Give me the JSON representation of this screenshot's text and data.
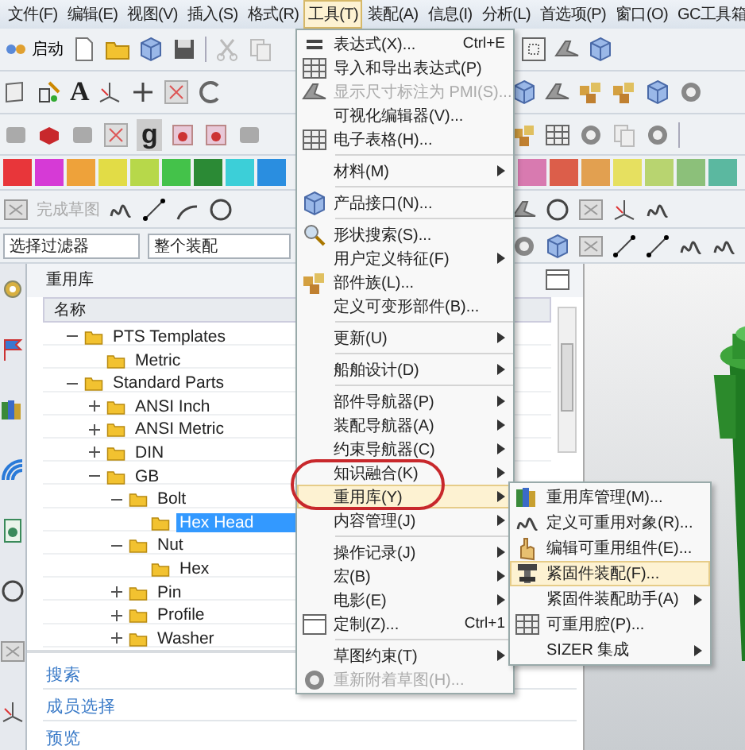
{
  "menu_bar": [
    {
      "label": "文件(F)",
      "selected": false
    },
    {
      "label": "编辑(E)",
      "selected": false
    },
    {
      "label": "视图(V)",
      "selected": false
    },
    {
      "label": "插入(S)",
      "selected": false
    },
    {
      "label": "格式(R)",
      "selected": false
    },
    {
      "label": "工具(T)",
      "selected": true
    },
    {
      "label": "装配(A)",
      "selected": false
    },
    {
      "label": "信息(I)",
      "selected": false
    },
    {
      "label": "分析(L)",
      "selected": false
    },
    {
      "label": "首选项(P)",
      "selected": false
    },
    {
      "label": "窗口(O)",
      "selected": false
    },
    {
      "label": "GC工具箱",
      "selected": false
    }
  ],
  "toolbars": {
    "launcher": {
      "label": "启动"
    },
    "glyphs": [
      "A",
      "g"
    ],
    "sketch_finish": {
      "label": "完成草图",
      "disabled": true
    },
    "filters": [
      {
        "value": "选择过滤器"
      },
      {
        "value": "整个装配"
      }
    ],
    "palette_left": [
      {
        "color": "#e8363a"
      },
      {
        "color": "#d63ad6"
      },
      {
        "color": "#eea23a"
      },
      {
        "color": "#e2dc46"
      },
      {
        "color": "#b7d84a"
      },
      {
        "color": "#44c24a"
      },
      {
        "color": "#2b8a35"
      },
      {
        "color": "#3ccfd8"
      },
      {
        "color": "#2a8ee0"
      }
    ],
    "palette_right": [
      {
        "color": "#d87ab0"
      },
      {
        "color": "#dc5e4a"
      },
      {
        "color": "#e2a050"
      },
      {
        "color": "#e6e060"
      },
      {
        "color": "#b8d470"
      },
      {
        "color": "#8cc07a"
      },
      {
        "color": "#5bb8a0"
      }
    ]
  },
  "panel": {
    "title": "重用库",
    "column": "名称",
    "tree": [
      {
        "label": "PTS Templates",
        "expanded": true,
        "selected": false,
        "children": [
          {
            "label": "Metric",
            "selected": false
          }
        ]
      },
      {
        "label": "Standard Parts",
        "expanded": true,
        "selected": false,
        "children": [
          {
            "label": "ANSI Inch",
            "expanded": false,
            "selected": false
          },
          {
            "label": "ANSI Metric",
            "expanded": false,
            "selected": false
          },
          {
            "label": "DIN",
            "expanded": false,
            "selected": false
          },
          {
            "label": "GB",
            "expanded": true,
            "selected": false,
            "children": [
              {
                "label": "Bolt",
                "expanded": true,
                "selected": false,
                "children": [
                  {
                    "label": "Hex Head",
                    "selected": true
                  }
                ]
              },
              {
                "label": "Nut",
                "expanded": true,
                "selected": false,
                "children": [
                  {
                    "label": "Hex",
                    "selected": false
                  }
                ]
              },
              {
                "label": "Pin",
                "expanded": false,
                "selected": false
              },
              {
                "label": "Profile",
                "expanded": false,
                "selected": false
              },
              {
                "label": "Washer",
                "expanded": false,
                "selected": false
              }
            ]
          }
        ]
      }
    ],
    "sections": [
      "搜索",
      "成员选择",
      "预览"
    ]
  },
  "tools_menu": {
    "items": [
      {
        "kind": "item",
        "label": "表达式(X)...",
        "shortcut": "Ctrl+E",
        "submenu": false,
        "disabled": false,
        "selected": false
      },
      {
        "kind": "item",
        "label": "导入和导出表达式(P)",
        "submenu": false,
        "disabled": false,
        "selected": false
      },
      {
        "kind": "item",
        "label": "显示尺寸标注为 PMI(S)...",
        "submenu": false,
        "disabled": true,
        "selected": false
      },
      {
        "kind": "item",
        "label": "可视化编辑器(V)...",
        "submenu": false,
        "disabled": false,
        "selected": false
      },
      {
        "kind": "item",
        "label": "电子表格(H)...",
        "submenu": false,
        "disabled": false,
        "selected": false
      },
      {
        "kind": "separator"
      },
      {
        "kind": "item",
        "label": "材料(M)",
        "submenu": true,
        "disabled": false,
        "selected": false
      },
      {
        "kind": "separator"
      },
      {
        "kind": "item",
        "label": "产品接口(N)...",
        "submenu": false,
        "disabled": false,
        "selected": false
      },
      {
        "kind": "separator"
      },
      {
        "kind": "item",
        "label": "形状搜索(S)...",
        "submenu": false,
        "disabled": false,
        "selected": false
      },
      {
        "kind": "item",
        "label": "用户定义特征(F)",
        "submenu": true,
        "disabled": false,
        "selected": false
      },
      {
        "kind": "item",
        "label": "部件族(L)...",
        "submenu": false,
        "disabled": false,
        "selected": false
      },
      {
        "kind": "item",
        "label": "定义可变形部件(B)...",
        "submenu": false,
        "disabled": false,
        "selected": false
      },
      {
        "kind": "separator"
      },
      {
        "kind": "item",
        "label": "更新(U)",
        "submenu": true,
        "disabled": false,
        "selected": false
      },
      {
        "kind": "separator"
      },
      {
        "kind": "item",
        "label": "船舶设计(D)",
        "submenu": true,
        "disabled": false,
        "selected": false
      },
      {
        "kind": "separator"
      },
      {
        "kind": "item",
        "label": "部件导航器(P)",
        "submenu": true,
        "disabled": false,
        "selected": false
      },
      {
        "kind": "item",
        "label": "装配导航器(A)",
        "submenu": true,
        "disabled": false,
        "selected": false
      },
      {
        "kind": "item",
        "label": "约束导航器(C)",
        "submenu": true,
        "disabled": false,
        "selected": false
      },
      {
        "kind": "item",
        "label": "知识融合(K)",
        "submenu": true,
        "disabled": false,
        "selected": false
      },
      {
        "kind": "item",
        "label": "重用库(Y)",
        "submenu": true,
        "disabled": false,
        "selected": true
      },
      {
        "kind": "item",
        "label": "内容管理(J)",
        "submenu": true,
        "disabled": false,
        "selected": false
      },
      {
        "kind": "separator"
      },
      {
        "kind": "item",
        "label": "操作记录(J)",
        "submenu": true,
        "disabled": false,
        "selected": false
      },
      {
        "kind": "item",
        "label": "宏(B)",
        "submenu": true,
        "disabled": false,
        "selected": false
      },
      {
        "kind": "item",
        "label": "电影(E)",
        "submenu": true,
        "disabled": false,
        "selected": false
      },
      {
        "kind": "item",
        "label": "定制(Z)...",
        "shortcut": "Ctrl+1",
        "submenu": false,
        "disabled": false,
        "selected": false
      },
      {
        "kind": "separator"
      },
      {
        "kind": "item",
        "label": "草图约束(T)",
        "submenu": true,
        "disabled": false,
        "selected": false
      },
      {
        "kind": "item",
        "label": "重新附着草图(H)...",
        "submenu": false,
        "disabled": true,
        "selected": false
      }
    ]
  },
  "reuse_submenu": {
    "items": [
      {
        "kind": "item",
        "label": "重用库管理(M)...",
        "submenu": false,
        "disabled": false,
        "selected": false
      },
      {
        "kind": "item",
        "label": "定义可重用对象(R)...",
        "submenu": false,
        "disabled": false,
        "selected": false
      },
      {
        "kind": "item",
        "label": "编辑可重用组件(E)...",
        "submenu": false,
        "disabled": false,
        "selected": false
      },
      {
        "kind": "item",
        "label": "紧固件装配(F)...",
        "submenu": false,
        "disabled": false,
        "selected": true
      },
      {
        "kind": "item",
        "label": "紧固件装配助手(A)",
        "submenu": true,
        "disabled": false,
        "selected": false
      },
      {
        "kind": "item",
        "label": "可重用腔(P)...",
        "submenu": false,
        "disabled": false,
        "selected": false
      },
      {
        "kind": "item",
        "label": "SIZER 集成",
        "submenu": true,
        "disabled": false,
        "selected": false
      }
    ]
  }
}
